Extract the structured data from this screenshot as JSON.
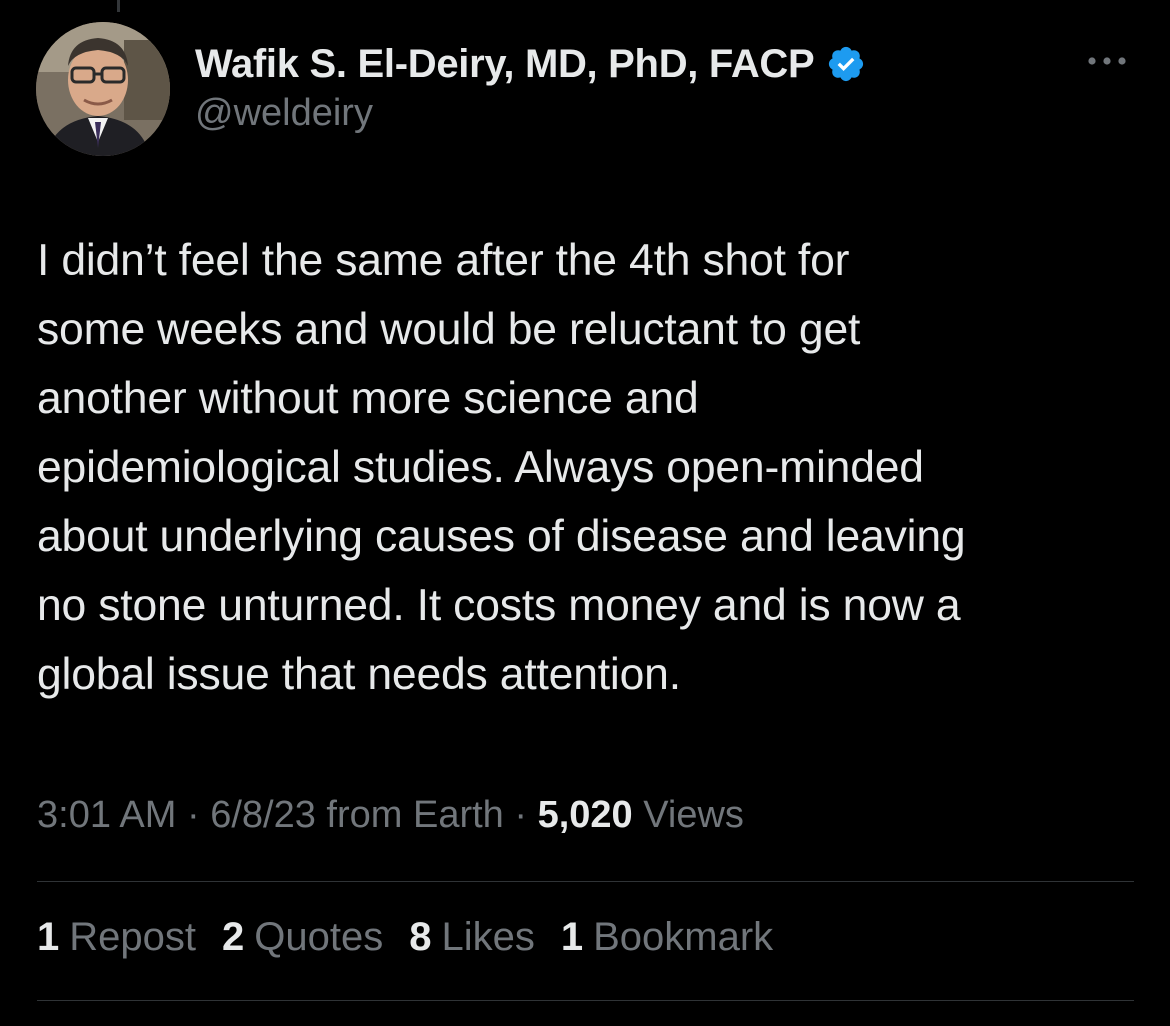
{
  "author": {
    "display_name": "Wafik S. El-Deiry, MD, PhD, FACP",
    "handle": "@weldeiry",
    "verified": true,
    "verified_color": "#1d9bf0"
  },
  "tweet": {
    "text": "I didn’t feel the same after the 4th shot for\nsome weeks and would be reluctant to get\nanother without more science and\nepidemiological studies. Always open-minded\nabout underlying causes of disease and leaving\nno stone unturned. It costs money and is now a\nglobal issue that needs attention."
  },
  "meta": {
    "time": "3:01 AM",
    "separator": "·",
    "date": "6/8/23",
    "source": "from Earth",
    "views_count": "5,020",
    "views_label": "Views"
  },
  "stats": {
    "reposts": {
      "count": "1",
      "label": "Repost"
    },
    "quotes": {
      "count": "2",
      "label": "Quotes"
    },
    "likes": {
      "count": "8",
      "label": "Likes"
    },
    "bookmarks": {
      "count": "1",
      "label": "Bookmark"
    }
  },
  "icons": {
    "more": "more-horizontal-icon",
    "verified": "verified-badge-icon"
  },
  "colors": {
    "background": "#000000",
    "primary_text": "#e7e9ea",
    "secondary_text": "#71767b",
    "divider": "#2f3336"
  }
}
